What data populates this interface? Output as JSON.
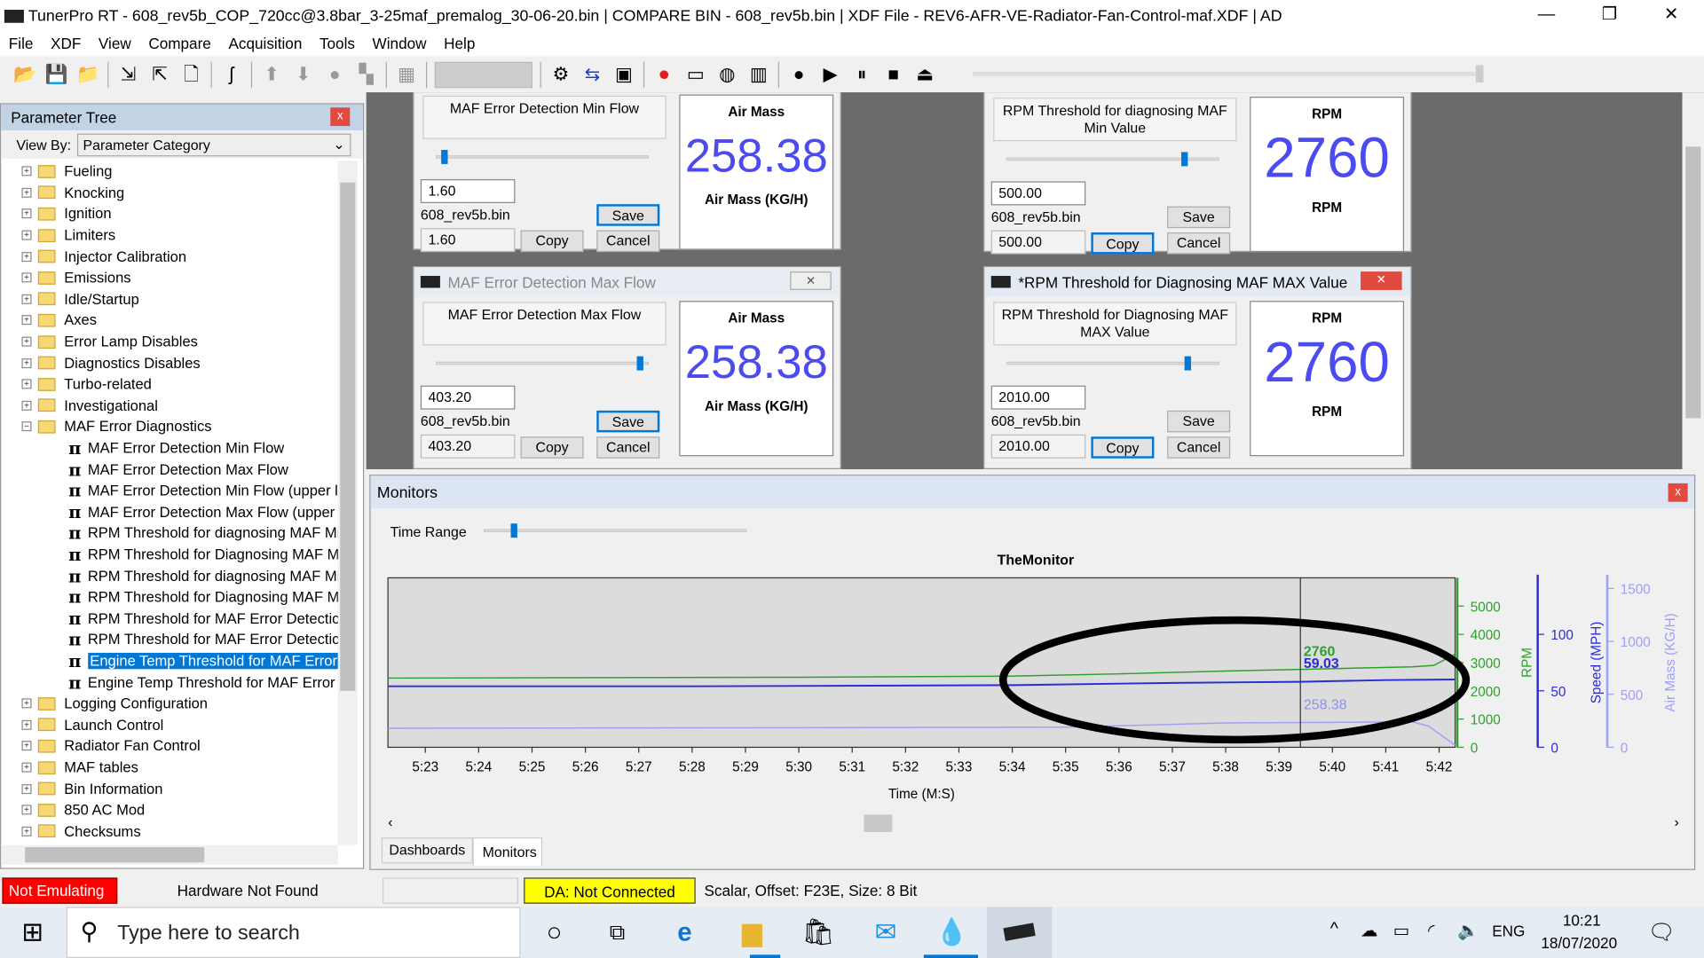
{
  "window": {
    "title": "TunerPro RT - 608_rev5b_COP_720cc@3.8bar_3-25maf_premalog_30-06-20.bin | COMPARE BIN - 608_rev5b.bin | XDF File - REV6-AFR-VE-Radiator-Fan-Control-maf.XDF | AD",
    "minimize": "—",
    "restore": "❐",
    "close": "✕"
  },
  "menu": [
    "File",
    "XDF",
    "View",
    "Compare",
    "Acquisition",
    "Tools",
    "Window",
    "Help"
  ],
  "toolbar_icons": [
    "open-icon",
    "save-icon",
    "open-folder-icon",
    "import-icon",
    "export-icon",
    "new-icon",
    "cable-icon",
    "up-icon",
    "down-icon",
    "circle-icon",
    "copy-icon",
    "chip-icon",
    "settings-icon",
    "swap-icon",
    "compare-icon",
    "record-icon",
    "folder-icon",
    "globe-icon",
    "chart-icon",
    "stop-circle-icon",
    "play-icon",
    "pause-icon",
    "stop-icon",
    "eject-icon"
  ],
  "tree": {
    "title": "Parameter Tree",
    "close": "x",
    "view_by_label": "View By:",
    "view_by_value": "Parameter Category",
    "categories_top": [
      "Fueling",
      "Knocking",
      "Ignition",
      "Limiters",
      "Injector Calibration",
      "Emissions",
      "Idle/Startup",
      "Axes",
      "Error Lamp Disables",
      "Diagnostics Disables",
      "Turbo-related",
      "Investigational"
    ],
    "open_category": "MAF Error Diagnostics",
    "children": [
      "MAF Error Detection Min Flow",
      "MAF Error Detection Max Flow",
      "MAF Error Detection Min Flow (upper l",
      "MAF Error Detection Max Flow (upper",
      "RPM Threshold for diagnosing MAF Mi",
      "RPM Threshold for Diagnosing MAF M/",
      "RPM Threshold for diagnosing MAF Mi",
      "RPM Threshold for Diagnosing MAF M/",
      "RPM Threshold for MAF Error Detectic",
      "RPM Threshold for MAF Error Detectic",
      "Engine Temp Threshold for MAF Error",
      "Engine Temp Threshold for MAF Error"
    ],
    "selected_child": 10,
    "categories_bottom": [
      "Logging Configuration",
      "Launch Control",
      "Radiator Fan Control",
      "MAF tables",
      "Bin Information",
      "850 AC Mod",
      "Checksums"
    ]
  },
  "panels": [
    {
      "window_title": "",
      "label": "MAF Error Detection Min Flow",
      "slider": 0.02,
      "value": "1.60",
      "compare_label": "608_rev5b.bin",
      "compare_value": "1.60",
      "save": "Save",
      "copy": "Copy",
      "cancel": "Cancel",
      "gauge_title": "Air Mass",
      "gauge_value": "258.38",
      "gauge_unit": "Air Mass (KG/H)"
    },
    {
      "window_title": "MAF Error Detection Max Flow",
      "label": "MAF Error Detection Max Flow",
      "slider": 0.97,
      "value": "403.20",
      "compare_label": "608_rev5b.bin",
      "compare_value": "403.20",
      "save": "Save",
      "copy": "Copy",
      "cancel": "Cancel",
      "gauge_title": "Air Mass",
      "gauge_value": "258.38",
      "gauge_unit": "Air Mass (KG/H)"
    },
    {
      "window_title": "",
      "label": "RPM Threshold for diagnosing MAF Min Value",
      "slider": 0.84,
      "value": "500.00",
      "compare_label": "608_rev5b.bin",
      "compare_value": "500.00",
      "save": "Save",
      "copy": "Copy",
      "cancel": "Cancel",
      "gauge_title": "RPM",
      "gauge_value": "2760",
      "gauge_unit": "RPM"
    },
    {
      "window_title": "*RPM Threshold for Diagnosing MAF MAX Value",
      "label": "RPM Threshold for Diagnosing MAF MAX Value",
      "slider": 0.86,
      "value": "2010.00",
      "compare_label": "608_rev5b.bin",
      "compare_value": "2010.00",
      "save": "Save",
      "copy": "Copy",
      "cancel": "Cancel",
      "gauge_title": "RPM",
      "gauge_value": "2760",
      "gauge_unit": "RPM"
    }
  ],
  "monitors": {
    "title": "Monitors",
    "close": "x",
    "time_range_label": "Time Range",
    "time_range": 0.1,
    "tabs": [
      "Dashboards",
      "Monitors"
    ],
    "active_tab": 1
  },
  "chart_data": {
    "type": "line",
    "title": "TheMonitor",
    "xlabel": "Time (M:S)",
    "x_ticks": [
      "5:23",
      "5:24",
      "5:25",
      "5:26",
      "5:27",
      "5:28",
      "5:29",
      "5:30",
      "5:31",
      "5:32",
      "5:33",
      "5:34",
      "5:35",
      "5:36",
      "5:37",
      "5:38",
      "5:39",
      "5:40",
      "5:41",
      "5:42"
    ],
    "xlim": [
      "5:22.3",
      "5:42.3"
    ],
    "cursor": "5:39.4",
    "grid": false,
    "axes": [
      {
        "label": "RPM",
        "color": "#2ca02c",
        "ylim": [
          0,
          6000
        ],
        "ticks": [
          0,
          1000,
          2000,
          3000,
          4000,
          5000
        ]
      },
      {
        "label": "Speed (MPH)",
        "color": "#2b2bd6",
        "ylim": [
          0,
          150
        ],
        "ticks": [
          0,
          50,
          100
        ]
      },
      {
        "label": "Air Mass (KG/H)",
        "color": "#9f9ff5",
        "ylim": [
          0,
          1600
        ],
        "ticks": [
          0,
          500,
          1000,
          1500
        ]
      }
    ],
    "series": [
      {
        "name": "RPM",
        "axis": 0,
        "cursor_label": "2760",
        "points": [
          [
            "5:22.3",
            2450
          ],
          [
            "5:30",
            2480
          ],
          [
            "5:34",
            2520
          ],
          [
            "5:36",
            2600
          ],
          [
            "5:38",
            2700
          ],
          [
            "5:39.4",
            2760
          ],
          [
            "5:41.5",
            2850
          ],
          [
            "5:41.9",
            2900
          ],
          [
            "5:42.3",
            3300
          ]
        ]
      },
      {
        "name": "Speed (MPH)",
        "axis": 1,
        "cursor_label": "59.03",
        "points": [
          [
            "5:22.3",
            54
          ],
          [
            "5:28",
            54
          ],
          [
            "5:34",
            55
          ],
          [
            "5:37",
            57
          ],
          [
            "5:39.4",
            58
          ],
          [
            "5:41",
            59.5
          ],
          [
            "5:42.3",
            60
          ]
        ]
      },
      {
        "name": "Air Mass (KG/H)",
        "axis": 2,
        "cursor_label": "258.38",
        "points": [
          [
            "5:22.3",
            180
          ],
          [
            "5:30",
            185
          ],
          [
            "5:35",
            190
          ],
          [
            "5:38",
            230
          ],
          [
            "5:40",
            235
          ],
          [
            "5:41.5",
            240
          ],
          [
            "5:41.8",
            200
          ],
          [
            "5:42.3",
            20
          ]
        ]
      }
    ],
    "annotation": "hand-drawn black ellipse around the latest data"
  },
  "status": {
    "emulation": "Not Emulating",
    "hardware": "Hardware Not Found",
    "da": "DA: Not Connected",
    "info": "Scalar, Offset: F23E,  Size: 8 Bit"
  },
  "taskbar": {
    "search_placeholder": "Type here to search",
    "lang": "ENG",
    "time": "10:21",
    "date": "18/07/2020"
  }
}
